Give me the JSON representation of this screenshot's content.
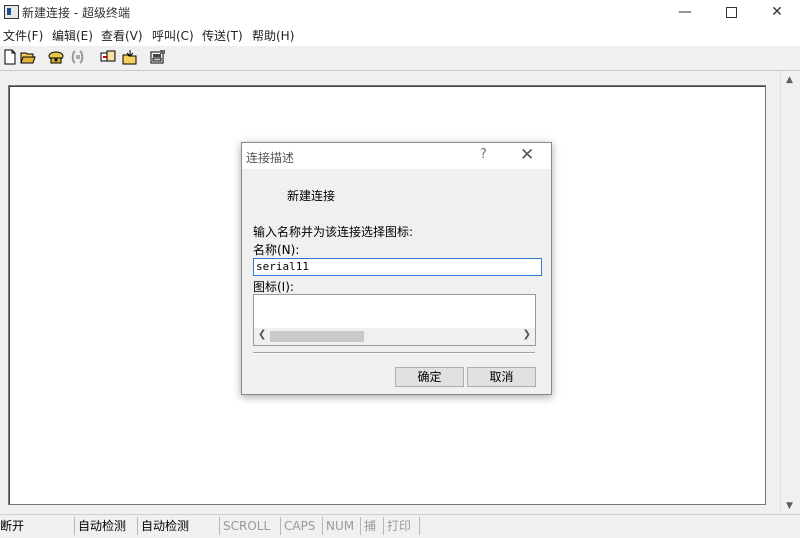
{
  "window": {
    "title": "新建连接 - 超级终端"
  },
  "menu": [
    "文件(F)",
    "编辑(E)",
    "查看(V)",
    "呼叫(C)",
    "传送(T)",
    "帮助(H)"
  ],
  "toolbar": [
    "new-icon",
    "open-icon",
    "connect-icon",
    "disconnect-icon",
    "send-icon",
    "receive-icon",
    "properties-icon"
  ],
  "dialog": {
    "title": "连接描述",
    "help": "?",
    "heading": "新建连接",
    "prompt": "输入名称并为该连接选择图标:",
    "name_label": "名称(N):",
    "name_value": "serial11",
    "icon_label": "图标(I):",
    "ok_label": "确定",
    "cancel_label": "取消"
  },
  "status": {
    "state": "断开",
    "detect1": "自动检测",
    "detect2": "自动检测",
    "scroll": "SCROLL",
    "caps": "CAPS",
    "num": "NUM",
    "capture": "捕",
    "print": "打印"
  }
}
